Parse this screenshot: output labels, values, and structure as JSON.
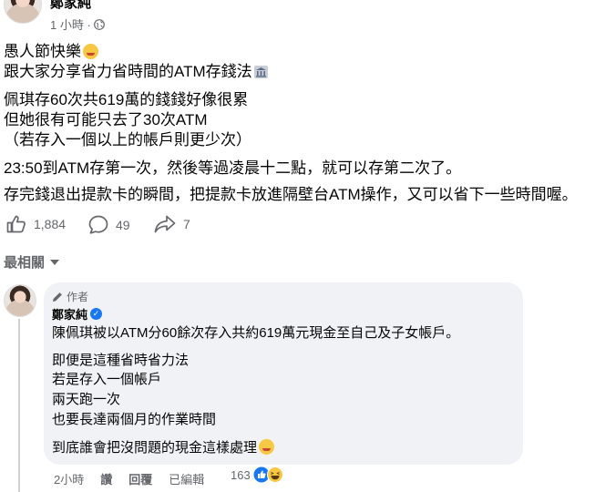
{
  "post": {
    "author": "鄭家純",
    "time": "1 小時",
    "lines": [
      "愚人節快樂",
      "跟大家分享省力省時間的ATM存錢法",
      "佩琪存60次共619萬的錢錢好像很累",
      "但她很有可能只去了30次ATM",
      "（若存入一個以上的帳戶則更少次）",
      "23:50到ATM存第一次，然後等過凌晨十二點，就可以存第二次了。",
      "存完錢退出提款卡的瞬間，把提款卡放進隔壁台ATM操作，又可以省下一些時間喔。"
    ],
    "likes": "1,884",
    "comments": "49",
    "shares": "7"
  },
  "sort": {
    "label": "最相關"
  },
  "comment": {
    "badge": "作者",
    "author": "鄭家純",
    "lines": [
      "陳佩琪被以ATM分60餘次存入共約619萬元現金至自己及子女帳戶。",
      "即便是這種省時省力法",
      "若是存入一個帳戶",
      "兩天跑一次",
      "也要長達兩個月的作業時間",
      "到底誰會把沒問題的現金這樣處理"
    ],
    "time": "2小時",
    "like": "讚",
    "reply": "回覆",
    "edited": "已編輯",
    "reaction_count": "163"
  },
  "colors": {
    "accent": "#1877f2",
    "text": "#050505",
    "muted": "#65676b",
    "bubble": "#f0f2f5"
  }
}
